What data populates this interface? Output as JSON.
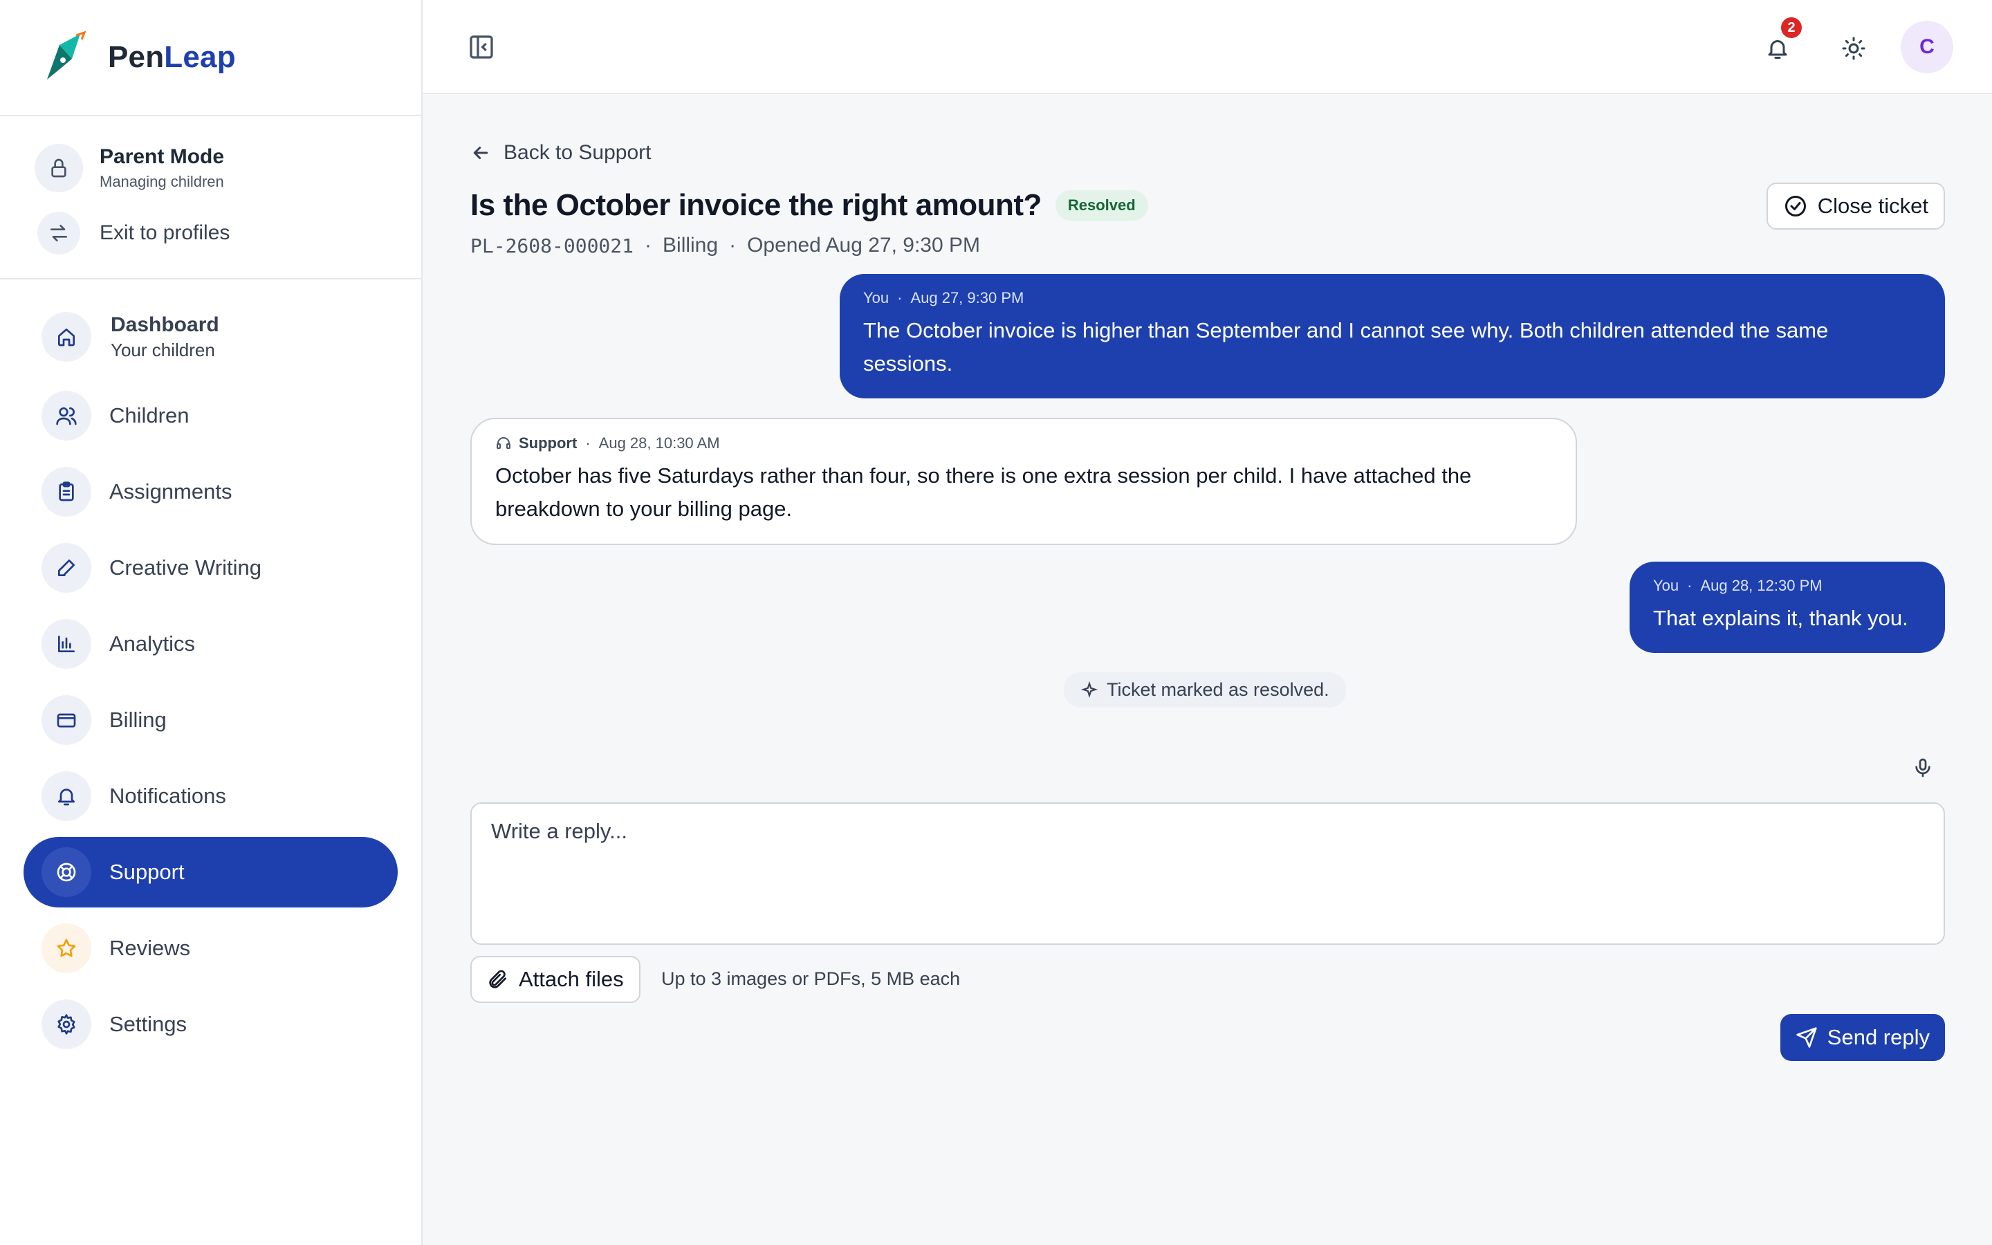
{
  "brand": {
    "name_part1": "Pen",
    "name_part2": "Leap"
  },
  "mode": {
    "title": "Parent Mode",
    "subtitle": "Managing children",
    "exit_label": "Exit to profiles"
  },
  "nav": {
    "items": [
      {
        "label": "Dashboard",
        "sublabel": "Your children",
        "icon": "home-icon"
      },
      {
        "label": "Children",
        "icon": "users-icon"
      },
      {
        "label": "Assignments",
        "icon": "clipboard-icon"
      },
      {
        "label": "Creative Writing",
        "icon": "pen-icon"
      },
      {
        "label": "Analytics",
        "icon": "bar-chart-icon"
      },
      {
        "label": "Billing",
        "icon": "credit-card-icon"
      },
      {
        "label": "Notifications",
        "icon": "bell-icon"
      },
      {
        "label": "Support",
        "icon": "lifebuoy-icon",
        "active": true
      },
      {
        "label": "Reviews",
        "icon": "star-icon"
      },
      {
        "label": "Settings",
        "icon": "gear-icon"
      }
    ]
  },
  "topbar": {
    "notification_count": "2",
    "avatar_initial": "C"
  },
  "ticket": {
    "back_label": "Back to Support",
    "title": "Is the October invoice the right amount?",
    "status": "Resolved",
    "close_label": "Close ticket",
    "code": "PL-2608-000021",
    "category": "Billing",
    "opened": "Opened Aug 27, 9:30 PM",
    "separator": "·"
  },
  "messages": [
    {
      "author": "You",
      "time": "Aug 27, 9:30 PM",
      "text": "The October invoice is higher than September and I cannot see why. Both children attended the same sessions."
    },
    {
      "author": "Support",
      "time": "Aug 28, 10:30 AM",
      "text": "October has five Saturdays rather than four, so there is one extra session per child. I have attached the breakdown to your billing page."
    },
    {
      "author": "You",
      "time": "Aug 28, 12:30 PM",
      "text": "That explains it, thank you."
    }
  ],
  "system_event": "Ticket marked as resolved.",
  "composer": {
    "placeholder": "Write a reply...",
    "attach_label": "Attach files",
    "attach_hint": "Up to 3 images or PDFs, 5 MB each",
    "send_label": "Send reply"
  },
  "colors": {
    "accent": "#1e40af",
    "resolved_bg": "#e3f3ea",
    "resolved_text": "#166534",
    "badge": "#dc2626",
    "avatar_bg": "#efe9fb",
    "avatar_text": "#6d28d9"
  }
}
